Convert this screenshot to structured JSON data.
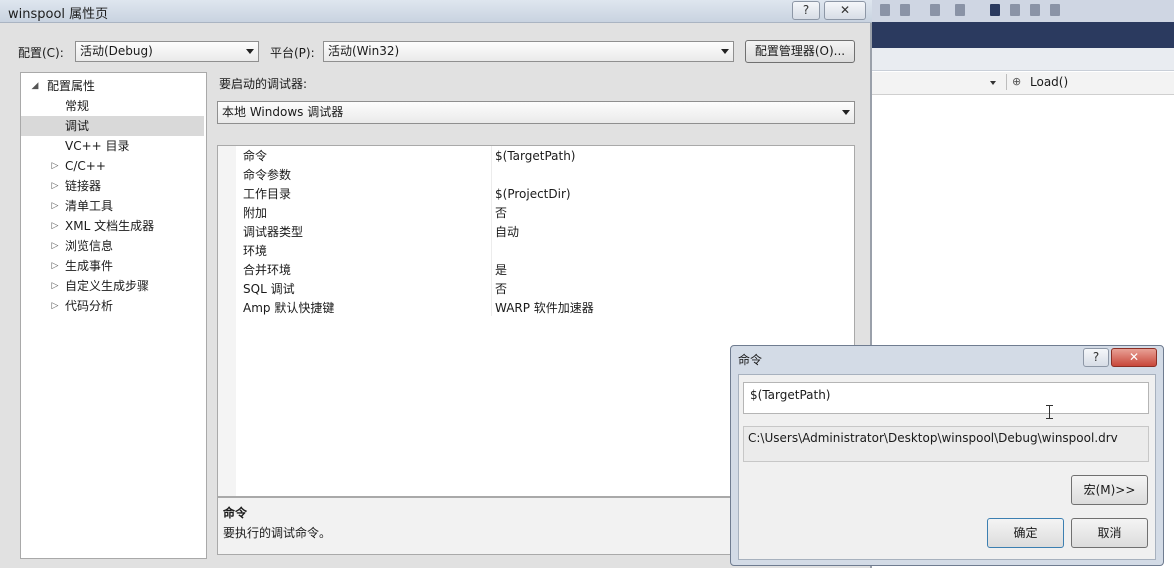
{
  "dialog": {
    "title": "winspool 属性页",
    "help_label": "?",
    "close_label": "✕",
    "config_label": "配置(C):",
    "config_value": "活动(Debug)",
    "platform_label": "平台(P):",
    "platform_value": "活动(Win32)",
    "config_manager_label": "配置管理器(O)...",
    "debugger_to_launch_label": "要启动的调试器:",
    "debugger_value": "本地 Windows 调试器",
    "tree": [
      {
        "label": "配置属性",
        "expander": "◢"
      },
      {
        "label": "常规",
        "expander": ""
      },
      {
        "label": "调试",
        "expander": ""
      },
      {
        "label": "VC++ 目录",
        "expander": ""
      },
      {
        "label": "C/C++",
        "expander": "▷"
      },
      {
        "label": "链接器",
        "expander": "▷"
      },
      {
        "label": "清单工具",
        "expander": "▷"
      },
      {
        "label": "XML 文档生成器",
        "expander": "▷"
      },
      {
        "label": "浏览信息",
        "expander": "▷"
      },
      {
        "label": "生成事件",
        "expander": "▷"
      },
      {
        "label": "自定义生成步骤",
        "expander": "▷"
      },
      {
        "label": "代码分析",
        "expander": "▷"
      }
    ],
    "properties": [
      {
        "name": "命令",
        "value": "$(TargetPath)"
      },
      {
        "name": "命令参数",
        "value": ""
      },
      {
        "name": "工作目录",
        "value": "$(ProjectDir)"
      },
      {
        "name": "附加",
        "value": "否"
      },
      {
        "name": "调试器类型",
        "value": "自动"
      },
      {
        "name": "环境",
        "value": ""
      },
      {
        "name": "合并环境",
        "value": "是"
      },
      {
        "name": "SQL 调试",
        "value": "否"
      },
      {
        "name": "Amp 默认快捷键",
        "value": "WARP 软件加速器"
      }
    ],
    "description": {
      "title": "命令",
      "text": "要执行的调试命令。"
    }
  },
  "command_dialog": {
    "title": "命令",
    "help_label": "?",
    "close_label": "✕",
    "input_value": "$(TargetPath)",
    "evaluated_value": "C:\\Users\\Administrator\\Desktop\\winspool\\Debug\\winspool.drv",
    "macros_label": "宏(M)>>",
    "ok_label": "确定",
    "cancel_label": "取消"
  },
  "ide": {
    "member_combo_value": "Load()"
  }
}
